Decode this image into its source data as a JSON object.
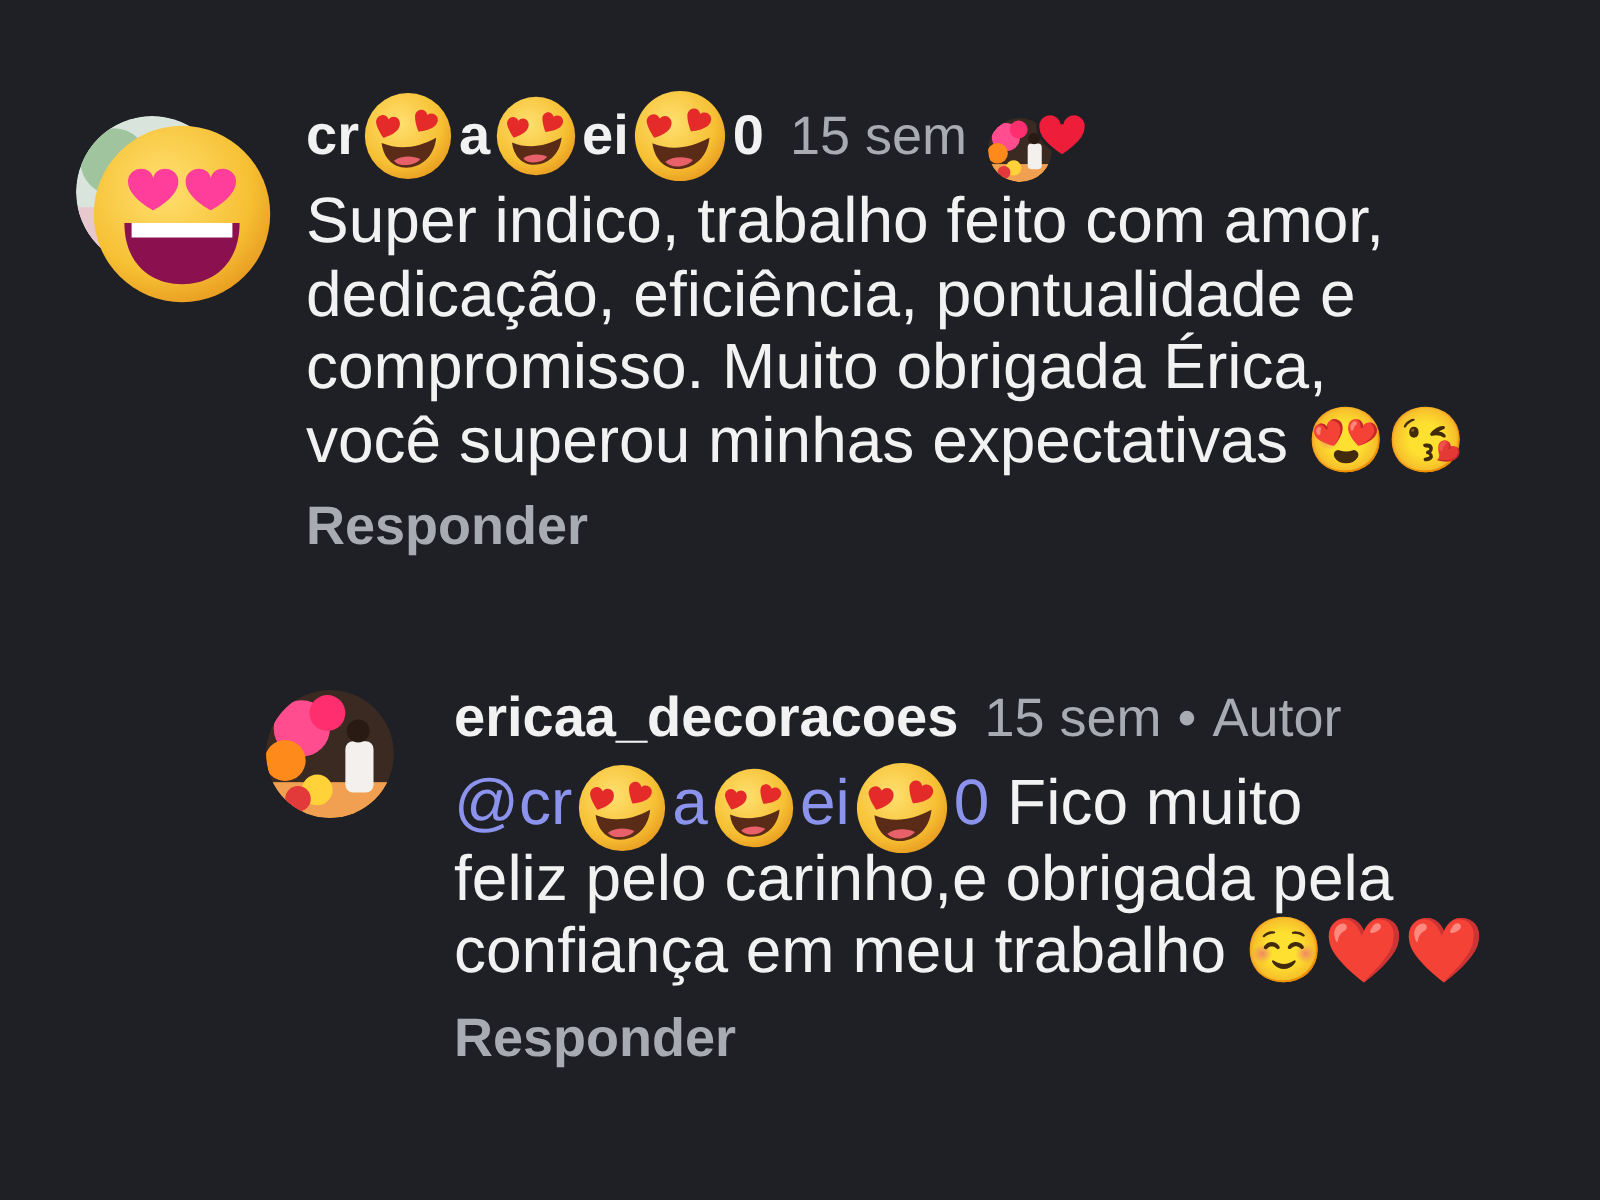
{
  "comments": [
    {
      "kind": "comment",
      "username_fragments": [
        "cr",
        "a",
        "ei",
        "0"
      ],
      "time": "15 sem",
      "liked_by_author": true,
      "text": "Super indico, trabalho feito com amor,\ndedicação, eficiência, pontualidade e\ncompromisso. Muito obrigada Érica,\nvocê superou minhas expectativas 😍😘",
      "reply": "Responder"
    },
    {
      "kind": "reply",
      "username_fragments": [
        "ericaa_decoracoes"
      ],
      "time": "15 sem",
      "separator": "•",
      "author_label": "Autor",
      "mention_fragments": [
        "@cr",
        "a",
        "ei",
        "0"
      ],
      "text": " Fico muito\nfeliz pelo carinho,e obrigada pela\nconfiança em meu trabalho ☺️❤️❤️",
      "reply": "Responder"
    }
  ]
}
